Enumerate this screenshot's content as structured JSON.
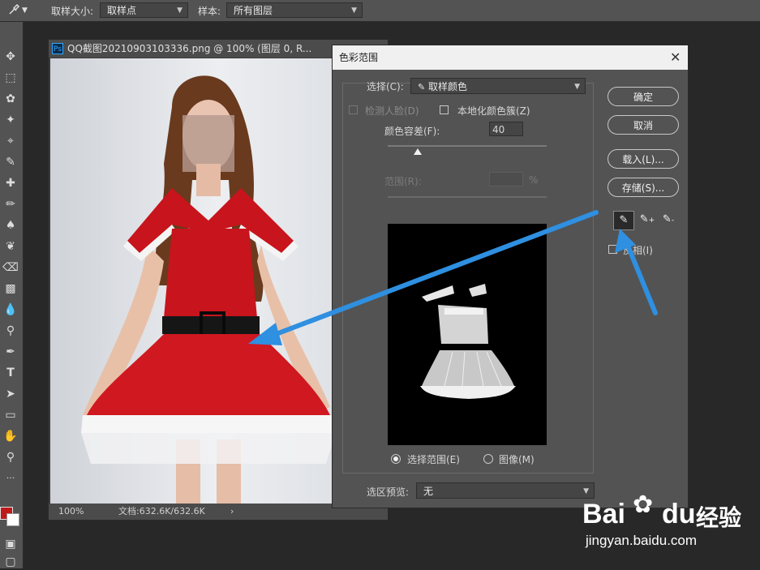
{
  "options_bar": {
    "sample_size_label": "取样大小:",
    "sample_size_value": "取样点",
    "sample_label": "样本:",
    "sample_value": "所有图层"
  },
  "document": {
    "ps_badge": "Ps",
    "tab_title": "QQ截图20210903103336.png @ 100% (图层 0, R...",
    "zoom": "100%",
    "doc_info": "文档:632.6K/632.6K"
  },
  "dialog": {
    "title": "色彩范围",
    "select_label": "选择(C):",
    "select_value": "取样颜色",
    "detect_faces": "检测人脸(D)",
    "localized_clusters": "本地化颜色簇(Z)",
    "fuzziness_label": "颜色容差(F):",
    "fuzziness_value": "40",
    "fuzziness_fraction": 0.19,
    "range_label": "范围(R):",
    "range_value": "",
    "range_unit": "%",
    "radio_selection": "选择范围(E)",
    "radio_image": "图像(M)",
    "selected_radio": "selection",
    "preview_label": "选区预览:",
    "preview_value": "无",
    "ok": "确定",
    "cancel": "取消",
    "load": "载入(L)...",
    "save": "存储(S)...",
    "invert": "反相(I)"
  },
  "watermark": {
    "brand_bai": "Bai",
    "brand_du": "du",
    "brand_cn": "经验",
    "url": "jingyan.baidu.com"
  },
  "colors": {
    "foreground": "#c01818",
    "background": "#ffffff",
    "arrow": "#2f8fe0"
  }
}
